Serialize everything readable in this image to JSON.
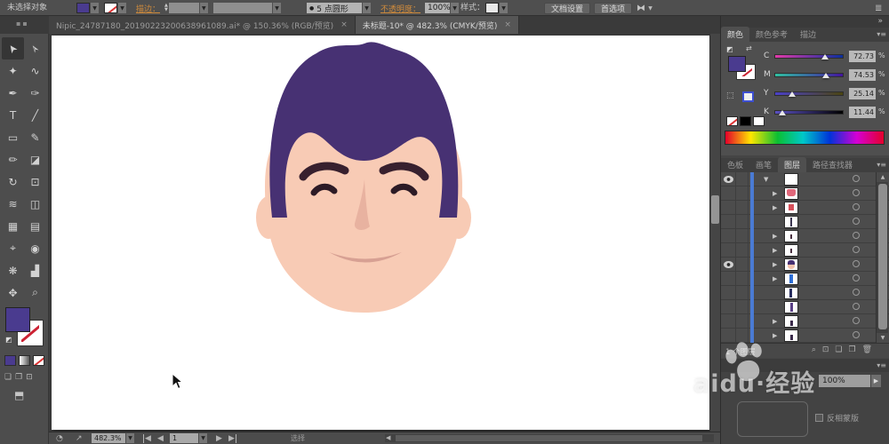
{
  "window": {
    "dock_collapse": "»",
    "panel_menu": "▾≡"
  },
  "control_bar": {
    "status": "未选择对象",
    "stroke_label": "描边：",
    "brush_bullet": "●",
    "brush_definition": "5 点圆形",
    "opacity_label": "不透明度：",
    "opacity_value": "100%",
    "style_label": "样式：",
    "doc_setup_button": "文档设置",
    "preferences_button": "首选项",
    "fill_color": "#4a3b8f"
  },
  "tabs": [
    {
      "title": "Nipic_24787180_20190223200638961089.ai* @ 150.36% (RGB/预览)",
      "close": "×",
      "active": false
    },
    {
      "title": "未标题-10* @ 482.3% (CMYK/预览)",
      "close": "×",
      "active": true
    }
  ],
  "tools": [
    {
      "name": "selection-tool",
      "glyph": "➤",
      "active": true,
      "rot": true
    },
    {
      "name": "direct-selection-tool",
      "glyph": "➢",
      "rot": true
    },
    {
      "name": "magic-wand-tool",
      "glyph": "✦"
    },
    {
      "name": "lasso-tool",
      "glyph": "∿"
    },
    {
      "name": "pen-tool",
      "glyph": "✒"
    },
    {
      "name": "curvature-tool",
      "glyph": "✑"
    },
    {
      "name": "type-tool",
      "glyph": "T"
    },
    {
      "name": "line-segment-tool",
      "glyph": "╱"
    },
    {
      "name": "rectangle-tool",
      "glyph": "▭"
    },
    {
      "name": "paintbrush-tool",
      "glyph": "✎"
    },
    {
      "name": "pencil-tool",
      "glyph": "✏"
    },
    {
      "name": "eraser-tool",
      "glyph": "◪"
    },
    {
      "name": "rotate-tool",
      "glyph": "↻"
    },
    {
      "name": "free-transform-tool",
      "glyph": "⊡"
    },
    {
      "name": "width-tool",
      "glyph": "≋"
    },
    {
      "name": "shape-builder-tool",
      "glyph": "◫"
    },
    {
      "name": "mesh-tool",
      "glyph": "▦"
    },
    {
      "name": "gradient-tool",
      "glyph": "▤"
    },
    {
      "name": "eyedropper-tool",
      "glyph": "⌖"
    },
    {
      "name": "blend-tool",
      "glyph": "◉"
    },
    {
      "name": "symbol-sprayer-tool",
      "glyph": "❋"
    },
    {
      "name": "column-graph-tool",
      "glyph": "▟"
    },
    {
      "name": "hand-tool",
      "glyph": "✥"
    },
    {
      "name": "zoom-tool",
      "glyph": "⌕"
    }
  ],
  "color_panel": {
    "tabs": [
      "颜色",
      "颜色参考",
      "描边"
    ],
    "active_tab": "颜色",
    "percent_sign": "%",
    "channels": [
      {
        "label": "C",
        "value": "72.73",
        "pct": 72.73,
        "grad_from": "#e23aa9",
        "grad_to": "#0a2f9e"
      },
      {
        "label": "M",
        "value": "74.53",
        "pct": 74.53,
        "grad_from": "#2fbfa0",
        "grad_to": "#43149e"
      },
      {
        "label": "Y",
        "value": "25.14",
        "pct": 25.14,
        "grad_from": "#4a40c8",
        "grad_to": "#4a4410"
      },
      {
        "label": "K",
        "value": "11.44",
        "pct": 11.44,
        "grad_from": "#5a50c0",
        "grad_to": "#000000"
      }
    ]
  },
  "panels": {
    "group2_tabs": [
      "色板",
      "画笔",
      "图层",
      "路径查找器"
    ],
    "group2_active": "图层"
  },
  "layers": {
    "layer_color": "#4a7bd4",
    "rows": [
      {
        "eye": true,
        "tri": "▼",
        "thumb": "plain"
      },
      {
        "eye": false,
        "tri": "▶",
        "thumb": "pink"
      },
      {
        "eye": false,
        "tri": "▶",
        "thumb": "red"
      },
      {
        "eye": false,
        "tri": "",
        "thumb": "line"
      },
      {
        "eye": false,
        "tri": "▶",
        "thumb": "mark"
      },
      {
        "eye": false,
        "tri": "▶",
        "thumb": "mark"
      },
      {
        "eye": true,
        "tri": "▶",
        "thumb": "face"
      },
      {
        "eye": false,
        "tri": "▶",
        "thumb": "blue"
      },
      {
        "eye": false,
        "tri": "",
        "thumb": "navy"
      },
      {
        "eye": false,
        "tri": "",
        "thumb": "purple"
      },
      {
        "eye": false,
        "tri": "▶",
        "thumb": "dark"
      },
      {
        "eye": false,
        "tri": "▶",
        "thumb": "dark"
      }
    ],
    "footer_text": "1 个图层",
    "scroll_up": "▲",
    "scroll_down": "▼",
    "footer_icons": [
      "⌕",
      "⊡",
      "❏",
      "❐",
      "🗑"
    ]
  },
  "transparency": {
    "value": "100%",
    "value_arrow": "▶",
    "invert_mask_label": "反相蒙版"
  },
  "status_bar": {
    "zoom": "482.3%",
    "artboard_number": "1",
    "hint": "选择"
  },
  "watermark": {
    "text": "aidu·经验"
  },
  "artwork": {
    "skin": "#f8cbb5",
    "hair": "#473173",
    "brow": "#38202e",
    "eye": "#2d1b26",
    "nose": "#e8b2a0",
    "mouth": "#d7a093"
  }
}
